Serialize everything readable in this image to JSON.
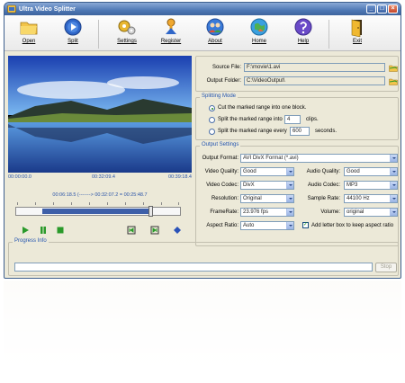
{
  "window": {
    "title": "Ultra Video Splitter"
  },
  "toolbar": {
    "open": "Open",
    "split": "Split",
    "settings": "Settings",
    "register": "Register",
    "about": "About",
    "home": "Home",
    "help": "Help",
    "exit": "Exit"
  },
  "player": {
    "time_start": "00:00:00.0",
    "time_current": "00:32:09.4",
    "time_end": "00:39:18.4",
    "range": "00:06:18.5 (-------> 00:32:07.2 = 00:25:48.7",
    "range_start_fraction": 0.16,
    "range_end_fraction": 0.82
  },
  "files": {
    "source_label": "Source File:",
    "source_value": "F:\\movie\\1.avi",
    "output_label": "Output Folder:",
    "output_value": "C:\\VideoOutput\\"
  },
  "splitting": {
    "title": "Splitting Mode",
    "opt1": "Cut the marked range into one block.",
    "opt2_pre": "Split the marked range into",
    "opt2_value": "4",
    "opt2_post": "clips.",
    "opt3_pre": "Split the marked range every",
    "opt3_value": "600",
    "opt3_post": "seconds."
  },
  "output": {
    "title": "Output Settings",
    "format_label": "Output Format:",
    "format_value": "AVI DivX Format (*.avi)",
    "vquality_label": "Video Quality:",
    "vquality_value": "Good",
    "aquality_label": "Audio Quality:",
    "aquality_value": "Good",
    "vcodec_label": "Video Codec:",
    "vcodec_value": "DivX",
    "acodec_label": "Audio Codec:",
    "acodec_value": "MP3",
    "res_label": "Resolution:",
    "res_value": "Original",
    "srate_label": "Sample Rate:",
    "srate_value": "44100 Hz",
    "fps_label": "FrameRate:",
    "fps_value": "23.976 fps",
    "vol_label": "Volume:",
    "vol_value": "original",
    "aspect_label": "Aspect Ratio:",
    "aspect_value": "Auto",
    "letterbox_label": "Add letter box to keep aspect ratio"
  },
  "progress": {
    "title": "Progress Info",
    "stop": "Stop",
    "value": 0
  },
  "colors": {
    "accent": "#3e5fa8",
    "title_bar": "#4e78b5",
    "group_title": "#2455b0"
  }
}
